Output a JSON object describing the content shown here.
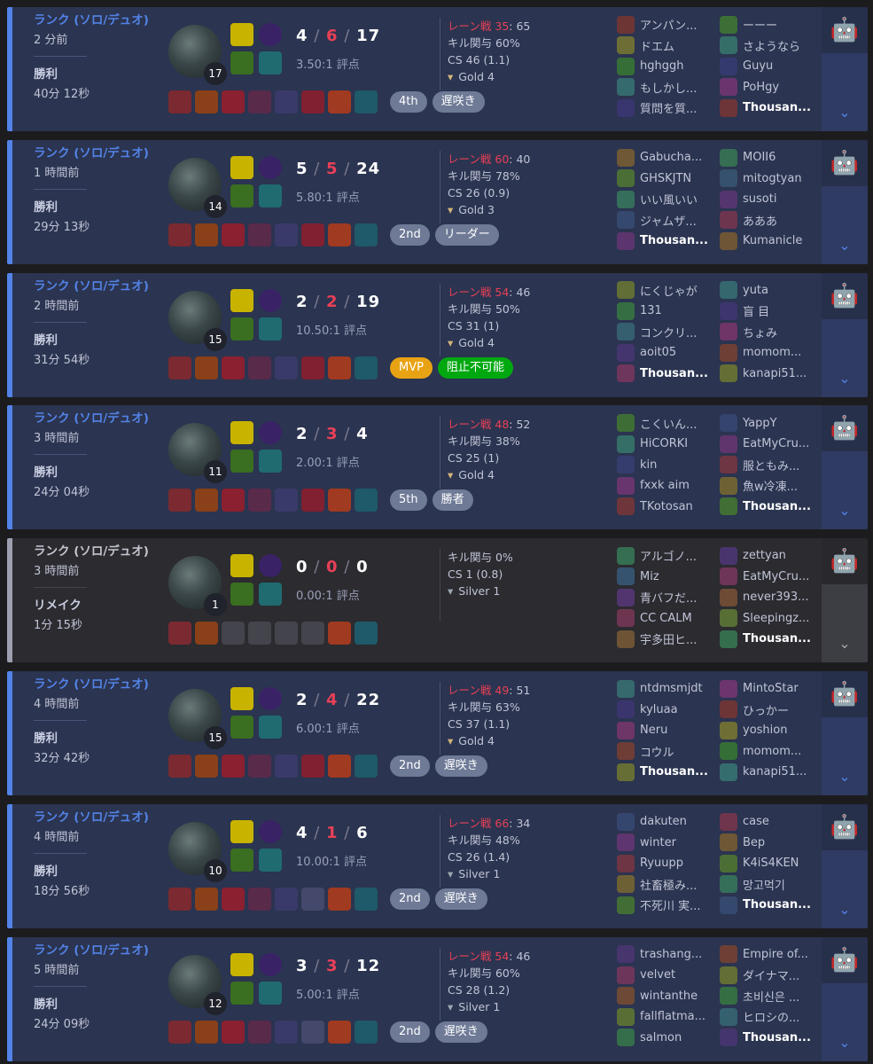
{
  "matches": [
    {
      "type": "win",
      "mode": "ランク (ソロ/デュオ)",
      "ago": "2 分前",
      "result": "勝利",
      "duration": "40分 12秒",
      "level": "17",
      "kda": {
        "k": "4",
        "d": "6",
        "a": "17"
      },
      "ratio": "3.50:1 評点",
      "items": [
        "item",
        "item",
        "item",
        "item",
        "item",
        "item",
        "item",
        "item"
      ],
      "badges": [
        {
          "label": "4th",
          "style": "gray"
        },
        {
          "label": "遅咲き",
          "style": "gray"
        }
      ],
      "lane": {
        "label": "レーン戦",
        "value": "35",
        "rest": ": 65"
      },
      "kp": "キル関与 60%",
      "cs": "CS 46 (1.1)",
      "tier": "Gold 4",
      "tier_kind": "gold",
      "team1": [
        "アンパン...",
        "ドエム",
        "hghggh",
        "もしかし...",
        "質問を質..."
      ],
      "team2": [
        "ーーー",
        "さようなら",
        "Guyu",
        "PoHgy",
        "Thousan..."
      ]
    },
    {
      "type": "win",
      "mode": "ランク (ソロ/デュオ)",
      "ago": "1 時間前",
      "result": "勝利",
      "duration": "29分 13秒",
      "level": "14",
      "kda": {
        "k": "5",
        "d": "5",
        "a": "24"
      },
      "ratio": "5.80:1 評点",
      "items": [
        "item",
        "item",
        "item",
        "item",
        "item",
        "item",
        "item",
        "item"
      ],
      "badges": [
        {
          "label": "2nd",
          "style": "gray"
        },
        {
          "label": "リーダー",
          "style": "gray"
        }
      ],
      "lane": {
        "label": "レーン戦",
        "value": "60",
        "rest": ": 40"
      },
      "kp": "キル関与 78%",
      "cs": "CS 26 (0.9)",
      "tier": "Gold 3",
      "tier_kind": "gold",
      "team1": [
        "Gabucha...",
        "GHSKJTN",
        "いい風いい",
        "ジャムザ...",
        "Thousan..."
      ],
      "team2": [
        "MOII6",
        "mitogtyan",
        "susoti",
        "あああ",
        "Kumanicle"
      ]
    },
    {
      "type": "win",
      "mode": "ランク (ソロ/デュオ)",
      "ago": "2 時間前",
      "result": "勝利",
      "duration": "31分 54秒",
      "level": "15",
      "kda": {
        "k": "2",
        "d": "2",
        "a": "19"
      },
      "ratio": "10.50:1 評点",
      "items": [
        "item",
        "item",
        "item",
        "item",
        "item",
        "item",
        "item",
        "item"
      ],
      "badges": [
        {
          "label": "MVP",
          "style": "mvp"
        },
        {
          "label": "阻止不可能",
          "style": "green"
        }
      ],
      "lane": {
        "label": "レーン戦",
        "value": "54",
        "rest": ": 46"
      },
      "kp": "キル関与 50%",
      "cs": "CS 31 (1)",
      "tier": "Gold 4",
      "tier_kind": "gold",
      "team1": [
        "にくじゃが",
        "131",
        "コンクリ...",
        "aoit05",
        "Thousan..."
      ],
      "team2": [
        "yuta",
        "盲 目",
        "ちょみ",
        "momom...",
        "kanapi51..."
      ]
    },
    {
      "type": "win",
      "mode": "ランク (ソロ/デュオ)",
      "ago": "3 時間前",
      "result": "勝利",
      "duration": "24分 04秒",
      "level": "11",
      "kda": {
        "k": "2",
        "d": "3",
        "a": "4"
      },
      "ratio": "2.00:1 評点",
      "items": [
        "item",
        "item",
        "item",
        "item",
        "item",
        "item",
        "item",
        "item"
      ],
      "badges": [
        {
          "label": "5th",
          "style": "gray"
        },
        {
          "label": "勝者",
          "style": "gray"
        }
      ],
      "lane": {
        "label": "レーン戦",
        "value": "48",
        "rest": ": 52"
      },
      "kp": "キル関与 38%",
      "cs": "CS 25 (1)",
      "tier": "Gold 4",
      "tier_kind": "gold",
      "team1": [
        "こくいん...",
        "HiCORKI",
        "kin",
        "fxxk aim",
        "TKotosan"
      ],
      "team2": [
        "YappY",
        "EatMyCru...",
        "服ともみ...",
        "魚w冷凍...",
        "Thousan..."
      ]
    },
    {
      "type": "remake",
      "mode": "ランク (ソロ/デュオ)",
      "ago": "3 時間前",
      "result": "リメイク",
      "duration": "1分 15秒",
      "level": "1",
      "kda": {
        "k": "0",
        "d": "0",
        "a": "0"
      },
      "ratio": "0.00:1 評点",
      "items": [
        "item",
        "item",
        "empty",
        "empty",
        "empty",
        "empty",
        "item",
        "item"
      ],
      "badges": [],
      "lane": null,
      "kp": "キル関与 0%",
      "kp_red": true,
      "cs": "CS 1 (0.8)",
      "tier": "Silver 1",
      "tier_kind": "silver",
      "team1": [
        "アルゴノ...",
        "Miz",
        "青バフだ...",
        "CC CALM",
        "宇多田ヒ..."
      ],
      "team2": [
        "zettyan",
        "EatMyCru...",
        "never393...",
        "Sleepingz...",
        "Thousan..."
      ]
    },
    {
      "type": "win",
      "mode": "ランク (ソロ/デュオ)",
      "ago": "4 時間前",
      "result": "勝利",
      "duration": "32分 42秒",
      "level": "15",
      "kda": {
        "k": "2",
        "d": "4",
        "a": "22"
      },
      "ratio": "6.00:1 評点",
      "items": [
        "item",
        "item",
        "item",
        "item",
        "item",
        "item",
        "item",
        "item"
      ],
      "badges": [
        {
          "label": "2nd",
          "style": "gray"
        },
        {
          "label": "遅咲き",
          "style": "gray"
        }
      ],
      "lane": {
        "label": "レーン戦",
        "value": "49",
        "rest": ": 51"
      },
      "kp": "キル関与 63%",
      "cs": "CS 37 (1.1)",
      "tier": "Gold 4",
      "tier_kind": "gold",
      "team1": [
        "ntdmsmjdt",
        "kyluaa",
        "Neru",
        "コウル",
        "Thousan..."
      ],
      "team2": [
        "MintoStar",
        "ひっかー",
        "yoshion",
        "momom...",
        "kanapi51..."
      ]
    },
    {
      "type": "win",
      "mode": "ランク (ソロ/デュオ)",
      "ago": "4 時間前",
      "result": "勝利",
      "duration": "18分 56秒",
      "level": "10",
      "kda": {
        "k": "4",
        "d": "1",
        "a": "6"
      },
      "ratio": "10.00:1 評点",
      "items": [
        "item",
        "item",
        "item",
        "item",
        "item",
        "empty",
        "item",
        "item"
      ],
      "badges": [
        {
          "label": "2nd",
          "style": "gray"
        },
        {
          "label": "遅咲き",
          "style": "gray"
        }
      ],
      "lane": {
        "label": "レーン戦",
        "value": "66",
        "rest": ": 34"
      },
      "kp": "キル関与 48%",
      "cs": "CS 26 (1.4)",
      "tier": "Silver 1",
      "tier_kind": "silver",
      "team1": [
        "dakuten",
        "winter",
        "Ryuupp",
        "社畜極み...",
        "不死川 実..."
      ],
      "team2": [
        "case",
        "Bep",
        "K4iS4KEN",
        "망고먹기",
        "Thousan..."
      ]
    },
    {
      "type": "win",
      "mode": "ランク (ソロ/デュオ)",
      "ago": "5 時間前",
      "result": "勝利",
      "duration": "24分 09秒",
      "level": "12",
      "kda": {
        "k": "3",
        "d": "3",
        "a": "12"
      },
      "ratio": "5.00:1 評点",
      "items": [
        "item",
        "item",
        "item",
        "item",
        "item",
        "empty",
        "item",
        "item"
      ],
      "badges": [
        {
          "label": "2nd",
          "style": "gray"
        },
        {
          "label": "遅咲き",
          "style": "gray"
        }
      ],
      "lane": {
        "label": "レーン戦",
        "value": "54",
        "rest": ": 46"
      },
      "kp": "キル関与 60%",
      "cs": "CS 28 (1.2)",
      "tier": "Silver 1",
      "tier_kind": "silver",
      "team1": [
        "trashang...",
        "velvet",
        "wintanthe",
        "fallflatma...",
        "salmon"
      ],
      "team2": [
        "Empire of...",
        "ダイナマ...",
        "초비신은 ...",
        "ヒロシの...",
        "Thousan..."
      ]
    }
  ],
  "highlight_name": "Thousan...",
  "icons": {
    "bot": "bot-icon",
    "chevron": "chevron-down-icon"
  }
}
